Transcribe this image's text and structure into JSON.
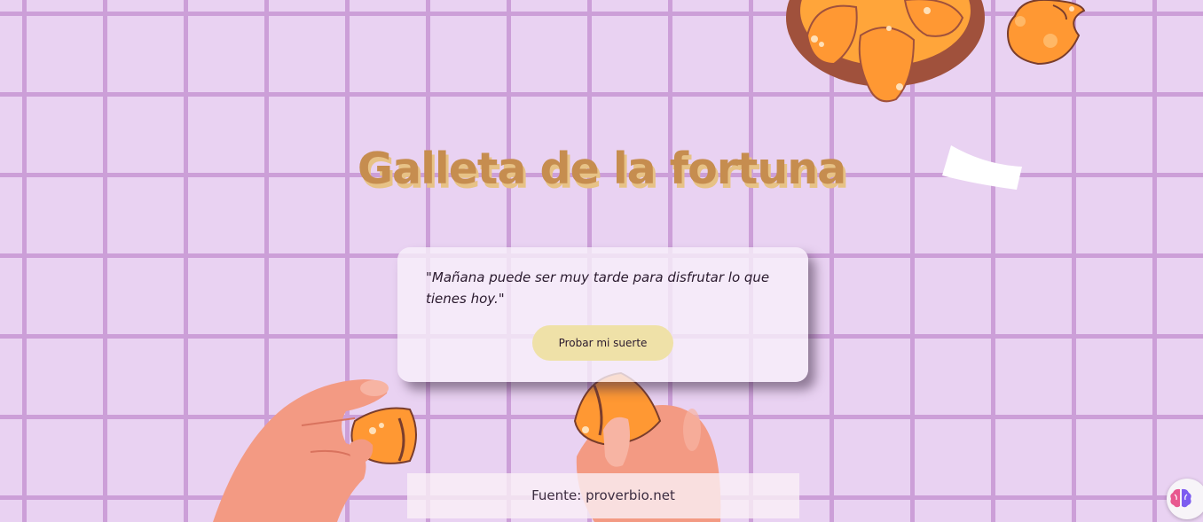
{
  "page": {
    "title": "Galleta de la fortuna"
  },
  "card": {
    "quote": "\"Mañana puede ser muy tarde para disfrutar lo que tienes hoy.\"",
    "button_label": "Probar mi suerte"
  },
  "footer": {
    "source": "Fuente: proverbio.net"
  },
  "icons": {
    "extension": "brain-icon"
  },
  "colors": {
    "background": "#e9d2f2",
    "grid": "#cc9fd8",
    "title": "#c68d4f",
    "title_shadow": "#e7c286",
    "button": "#efe1a8",
    "cookie": "#ff9833",
    "hand": "#f39a83"
  }
}
